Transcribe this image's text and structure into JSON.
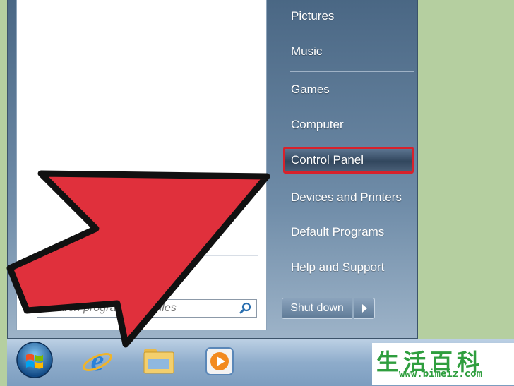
{
  "right_menu": {
    "pictures": "Pictures",
    "music": "Music",
    "games": "Games",
    "computer": "Computer",
    "control_panel": "Control Panel",
    "devices_printers": "Devices and Printers",
    "default_programs": "Default Programs",
    "help_support": "Help and Support"
  },
  "search": {
    "placeholder": "Search programs and files"
  },
  "shutdown": {
    "label": "Shut down"
  },
  "taskbar": {
    "icons": [
      "windows-start-orb",
      "internet-explorer",
      "file-explorer",
      "media-player"
    ]
  },
  "colors": {
    "highlight_border": "#d8212b",
    "arrow_fill": "#e0303c",
    "watermark": "#2f9e3e"
  },
  "watermark": {
    "chars": "生活百科",
    "url": "www.bimeiz.com"
  }
}
